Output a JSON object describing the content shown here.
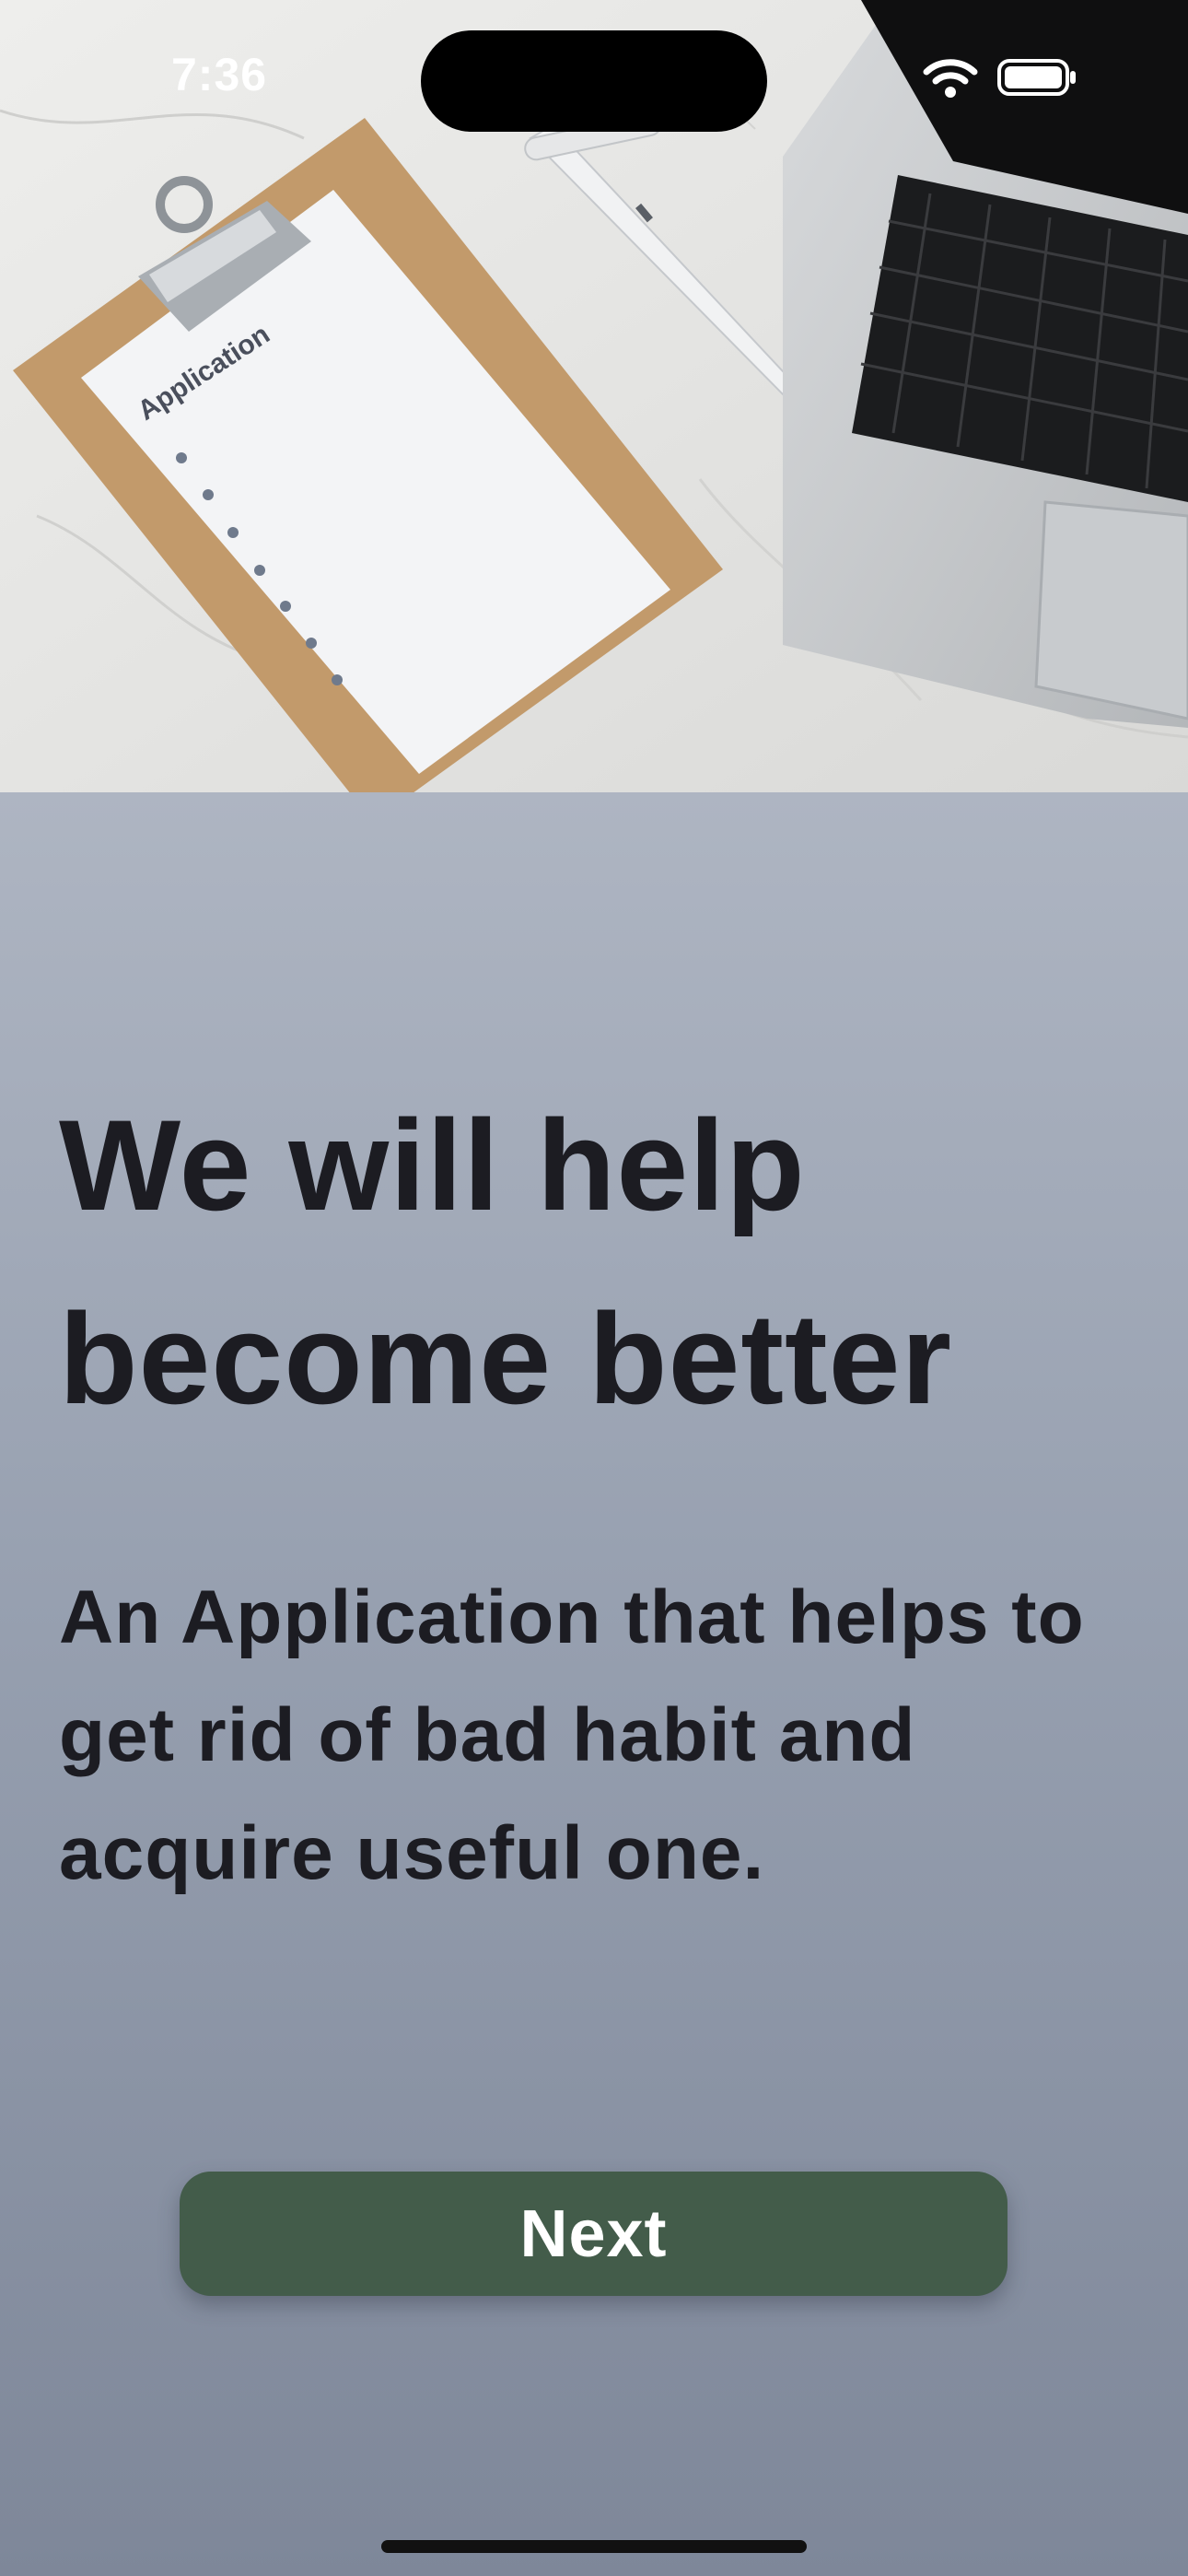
{
  "status_bar": {
    "time": "7:36",
    "icons": [
      "wifi-icon",
      "battery-icon"
    ]
  },
  "hero": {
    "image": "desk-photo",
    "clipboard_text": "Application"
  },
  "headline": "We will help become better",
  "subtitle": "An Application that helps to get rid of bad habit and acquire useful one.",
  "next_button": {
    "label": "Next",
    "color": "#435c4a"
  },
  "colors": {
    "panel_top": "#aeb5c2",
    "panel_bottom": "#7e8799",
    "text": "#1c1c22"
  }
}
